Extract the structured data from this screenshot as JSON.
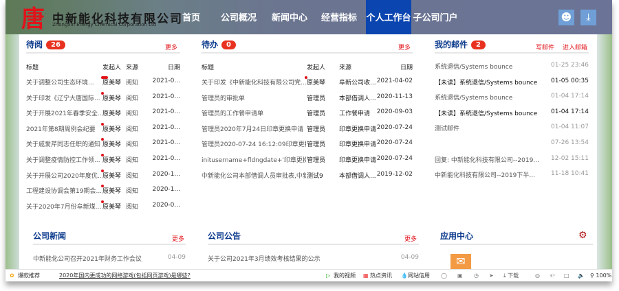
{
  "header": {
    "company_name": "中新能化科技有限公司",
    "company_name_en": "Zhongxin Energy Chemical Corporation Ltd",
    "logo_glyph": "唐",
    "nav": [
      {
        "label": "首页"
      },
      {
        "label": "公司概况"
      },
      {
        "label": "新闻中心"
      },
      {
        "label": "经营指标"
      },
      {
        "label": "个人工作台",
        "active": true
      },
      {
        "label": "子公司门户"
      }
    ],
    "accent": "#0b45b0"
  },
  "pending_read": {
    "title": "待阅",
    "count": "26",
    "more": "更多",
    "columns": [
      "标题",
      "发起人",
      "来源",
      "日期"
    ],
    "rows": [
      [
        "关于调整公司生态环境...",
        "原美琴",
        "阅知",
        "2021-0..."
      ],
      [
        "关于印发《辽宁大唐国际...",
        "原美琴",
        "阅知",
        "2021-0..."
      ],
      [
        "关于开展2021年春季安全...",
        "原美琴",
        "阅知",
        "2021-0..."
      ],
      [
        "2021年第8期周例会纪要",
        "原美琴",
        "阅知",
        "2021-0..."
      ],
      [
        "关于戚爱芹同志任职的通知",
        "原美琴",
        "阅知",
        "2021-0..."
      ],
      [
        "关于调整疫情防控工作领...",
        "原美琴",
        "阅知",
        "2021-0..."
      ],
      [
        "关于开展公司2020年度优...",
        "原美琴",
        "阅知",
        "2020-1..."
      ],
      [
        "工程建设协调会第19期会...",
        "原美琴",
        "阅知",
        "2020-1..."
      ],
      [
        "关于2020年7月份阜新煤...",
        "原美琴",
        "阅知",
        "2020-0..."
      ]
    ]
  },
  "todo": {
    "title": "待办",
    "count": "0",
    "more": "更多",
    "columns": [
      "标题",
      "发起人",
      "来源",
      "日期"
    ],
    "rows": [
      [
        "关于印发《中新能化科技有限公司党...",
        "原美琴",
        "阜新公司收...",
        "2021-04-02"
      ],
      [
        "管理员的审批单",
        "管理员",
        "本部借调人...",
        "2020-11-13"
      ],
      [
        "管理员的工作餐申请单",
        "管理员",
        "工作餐申请",
        "2020-09-03"
      ],
      [
        "管理员2020年7月24日印章更换申请",
        "管理员",
        "印章更换申请",
        "2020-07-24"
      ],
      [
        "管理员2020-07-24 16:12:09印章更换...",
        "管理员",
        "印章更换申请",
        "2020-07-24"
      ],
      [
        "initusername+fldngdate+'印章更换...",
        "管理员",
        "印章更换申请",
        "2020-07-24"
      ],
      [
        "中新能化公司本部借调人员审批表,中新...",
        "测试9",
        "本部借调人...",
        "2019-12-02"
      ]
    ]
  },
  "mail": {
    "title": "我的邮件",
    "count": "2",
    "write": "写邮件",
    "inbox": "进入邮箱",
    "rows": [
      [
        "系统退信/Systems bounce",
        "01-25 23:46",
        false
      ],
      [
        "【未读】系统退信/Systems bounce",
        "01-05 00:35",
        true
      ],
      [
        "系统退信/Systems bounce",
        "01-04 17:14",
        false
      ],
      [
        "【未读】系统退信/Systems bounce",
        "01-04 17:14",
        true
      ],
      [
        "测试邮件",
        "01-04 11:07",
        false
      ],
      [
        "",
        "07-26 13:54",
        false
      ],
      [
        "回复: 中新能化科技有限公司--2019...",
        "12-02 15:11",
        false
      ],
      [
        "中新能化科技有限公司--2019下半...",
        "11-18 10:41",
        false
      ]
    ]
  },
  "news": {
    "title": "公司新闻",
    "more": "更多",
    "rows": [
      [
        "中新能化公司召开2021年财务工作会议",
        "04-09"
      ]
    ]
  },
  "notice": {
    "title": "公司公告",
    "more": "更多",
    "rows": [
      [
        "关于公司2021年3月绩效考核结果的公示",
        "04-09"
      ]
    ]
  },
  "apps": {
    "title": "应用中心"
  },
  "statusbar": {
    "hot": "爆款推荐",
    "headline": "2020年国内更成功的网络游戏(包括网页游戏)是哪些?",
    "video": "我的视频",
    "news": "热点资讯",
    "credit": "网站信用",
    "download": "下载",
    "zoom": "100%"
  }
}
